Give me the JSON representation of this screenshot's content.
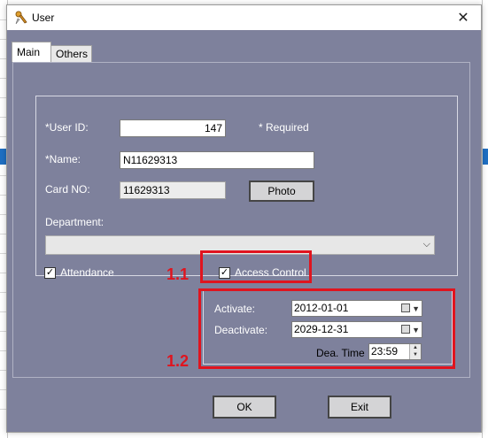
{
  "window": {
    "title": "User",
    "close_glyph": "✕"
  },
  "tabs": [
    {
      "label": "Main",
      "active": true
    },
    {
      "label": "Others",
      "active": false
    }
  ],
  "form": {
    "user_id_label": "*User ID:",
    "user_id_value": "147",
    "required_note": "* Required",
    "name_label": "*Name:",
    "name_value": "N11629313",
    "card_no_label": "Card NO:",
    "card_no_value": "11629313",
    "photo_button": "Photo",
    "department_label": "Department:",
    "department_value": ""
  },
  "options": {
    "attendance_label": "Attendance",
    "attendance_checked": true,
    "access_control_label": "Access Control",
    "access_control_checked": true,
    "activate_label": "Activate:",
    "activate_value": "2012-01-01",
    "deactivate_label": "Deactivate:",
    "deactivate_value": "2029-12-31",
    "dea_time_label": "Dea. Time",
    "dea_time_value": "23:59"
  },
  "annotations": {
    "a1": "1.1",
    "a2": "1.2"
  },
  "buttons": {
    "ok": "OK",
    "exit": "Exit"
  },
  "colors": {
    "client_bg": "#7e819c",
    "annotation": "#e0141e"
  },
  "icons": {
    "title": "user-key-icon",
    "close": "close-icon",
    "dropdown": "chevron-down-icon",
    "calendar": "calendar-icon"
  }
}
